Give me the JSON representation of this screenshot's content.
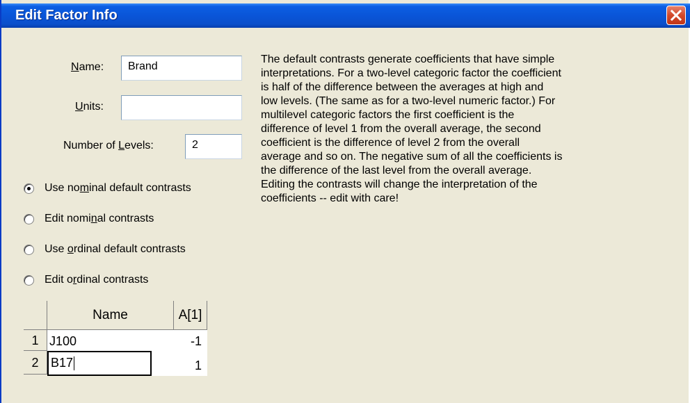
{
  "window": {
    "title": "Edit Factor Info",
    "close_icon": "close-icon"
  },
  "form": {
    "name_label_pre": "",
    "name_label_u": "N",
    "name_label_post": "ame:",
    "name_value": "Brand",
    "units_label_u": "U",
    "units_label_post": "nits:",
    "units_value": "",
    "levels_label_pre": "Number of ",
    "levels_label_u": "L",
    "levels_label_post": "evels:",
    "levels_value": "2"
  },
  "contrast_options": [
    {
      "pre": "Use no",
      "u": "m",
      "post": "inal default contrasts",
      "checked": true
    },
    {
      "pre": "Edit nomi",
      "u": "n",
      "post": "al contrasts",
      "checked": false
    },
    {
      "pre": "Use ",
      "u": "o",
      "post": "rdinal default contrasts",
      "checked": false
    },
    {
      "pre": "Edit o",
      "u": "r",
      "post": "dinal contrasts",
      "checked": false
    }
  ],
  "description_lines": [
    "The default contrasts generate coefficients that have simple",
    "interpretations. For a two-level categoric factor the coefficient",
    "is half of the difference between the averages at high and",
    "low levels.  (The same as for a two-level numeric factor.)  For",
    "multilevel categoric factors the first coefficient is the",
    "difference of level 1 from the overall average, the second",
    "coefficient is the difference of level 2 from the overall",
    "average and so on. The negative sum of all the coefficients is",
    "the difference of the last level from the overall average.",
    "Editing the contrasts will change the interpretation of the",
    "coefficients -- edit with care!"
  ],
  "grid": {
    "headers": [
      "Name",
      "A[1]"
    ],
    "rows": [
      {
        "num": "1",
        "name": "J100",
        "a1": "-1"
      },
      {
        "num": "2",
        "name": "B17",
        "a1": "1"
      }
    ]
  }
}
